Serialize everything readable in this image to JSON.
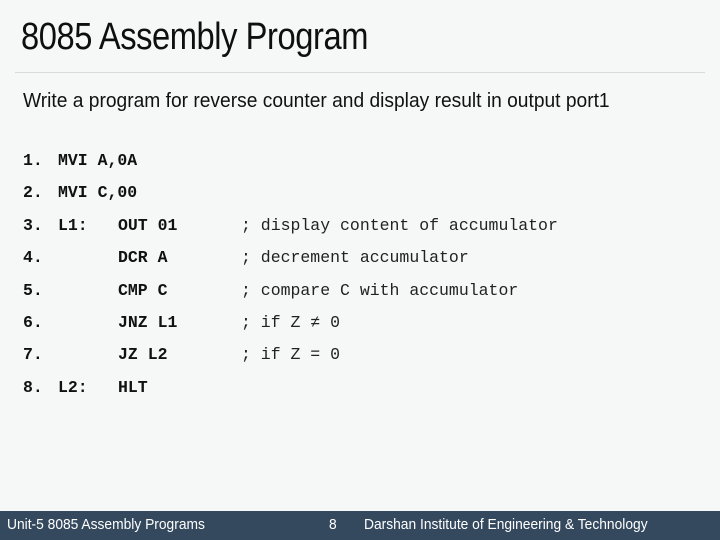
{
  "title": "8085 Assembly Program",
  "description": "Write a program for reverse counter and display result in output port1",
  "code": [
    {
      "num": "1.",
      "label": "",
      "instr": "MVI A,0A",
      "comment": ""
    },
    {
      "num": "2.",
      "label": "",
      "instr": "MVI C,00",
      "comment": ""
    },
    {
      "num": "3.",
      "label": "L1:",
      "instr": "OUT 01",
      "comment": "; display content of accumulator"
    },
    {
      "num": "4.",
      "label": "",
      "instr": "DCR A",
      "comment": "; decrement accumulator"
    },
    {
      "num": "5.",
      "label": "",
      "instr": "CMP C",
      "comment": "; compare C with accumulator"
    },
    {
      "num": "6.",
      "label": "",
      "instr": "JNZ L1",
      "comment": "; if Z ≠ 0"
    },
    {
      "num": "7.",
      "label": "",
      "instr": "JZ L2",
      "comment": "; if Z = 0"
    },
    {
      "num": "8.",
      "label": "L2:",
      "instr": "HLT",
      "comment": ""
    }
  ],
  "footer": {
    "left": "Unit-5 8085 Assembly Programs",
    "page": "8",
    "right": "Darshan Institute of Engineering & Technology"
  }
}
